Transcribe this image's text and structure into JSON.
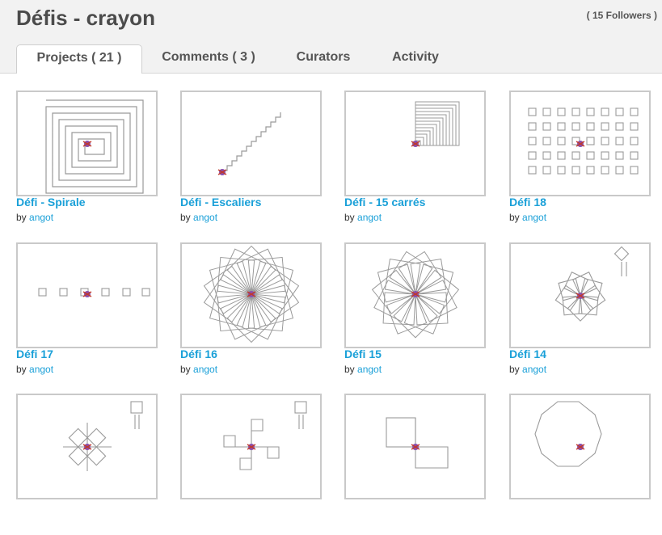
{
  "header": {
    "title": "Défis - crayon",
    "followers": "( 15 Followers )"
  },
  "tabs": [
    {
      "label": "Projects ( 21 )",
      "active": true
    },
    {
      "label": "Comments ( 3 )",
      "active": false
    },
    {
      "label": "Curators",
      "active": false
    },
    {
      "label": "Activity",
      "active": false
    }
  ],
  "by_label": "by",
  "projects": [
    {
      "title": "Défi - Spirale",
      "author": "angot"
    },
    {
      "title": "Défi - Escaliers",
      "author": "angot"
    },
    {
      "title": "Défi - 15 carrés",
      "author": "angot"
    },
    {
      "title": "Défi 18",
      "author": "angot"
    },
    {
      "title": "Défi 17",
      "author": "angot"
    },
    {
      "title": "Défi 16",
      "author": "angot"
    },
    {
      "title": "Défi 15",
      "author": "angot"
    },
    {
      "title": "Défi 14",
      "author": "angot"
    },
    {
      "title": "",
      "author": ""
    },
    {
      "title": "",
      "author": ""
    },
    {
      "title": "",
      "author": ""
    },
    {
      "title": "",
      "author": ""
    }
  ],
  "colors": {
    "link": "#1aa0d8",
    "header_bg": "#f2f2f2",
    "drawing_stroke": "#9a9a9a"
  }
}
